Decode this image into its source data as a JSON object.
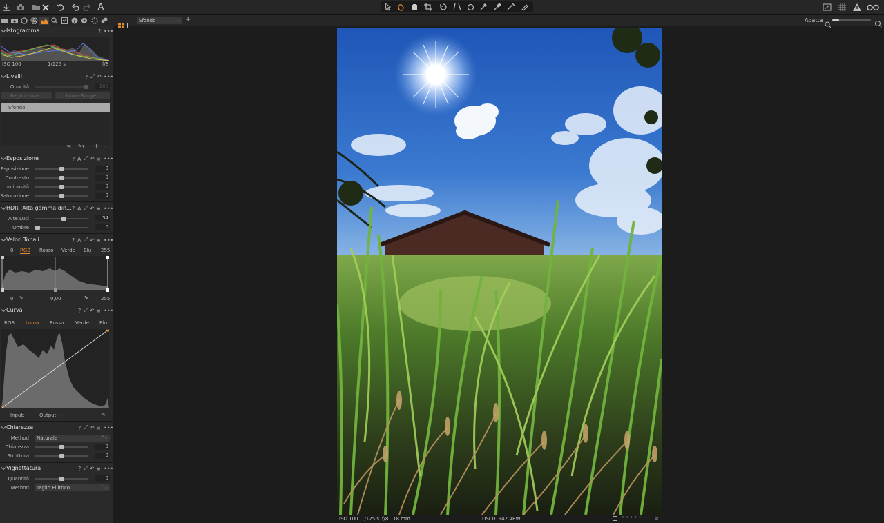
{
  "zoom": {
    "label": "Adatta"
  },
  "view": {
    "layer_select": "Sfondo"
  },
  "panels": {
    "istogramma": {
      "title": "Istogramma",
      "iso": "ISO 100",
      "shutter": "1/125 s",
      "aperture": "f/8"
    },
    "livelli": {
      "title": "Livelli",
      "opacita_label": "Opacità",
      "opacita_value": "100",
      "regolazione": "Regolazione",
      "luma_range": "Luma Range...",
      "layer_name": "Sfondo"
    },
    "esposizione": {
      "title": "Esposizione",
      "rows": [
        {
          "label": "Esposizione",
          "value": "0"
        },
        {
          "label": "Contrasto",
          "value": "0"
        },
        {
          "label": "Luminosità",
          "value": "0"
        },
        {
          "label": "Saturazione",
          "value": "0"
        }
      ]
    },
    "hdr": {
      "title": "HDR (Alta gamma din...",
      "rows": [
        {
          "label": "Alte Luci",
          "value": "54"
        },
        {
          "label": "Ombre",
          "value": "0"
        }
      ]
    },
    "valori_tonali": {
      "title": "Valori Tonali",
      "left": "0",
      "right": "255",
      "tabs": [
        "RGB",
        "Rosso",
        "Verde",
        "Blu"
      ],
      "active_tab": "RGB",
      "in_black": "0",
      "mid": "0,00",
      "in_white": "255"
    },
    "curva": {
      "title": "Curva",
      "tabs": [
        "RGB",
        "Luma",
        "Rosso",
        "Verde",
        "Blu"
      ],
      "active_tab": "Luma",
      "input_label": "Input:",
      "input_value": "--",
      "output_label": "Output:",
      "output_value": "--"
    },
    "chiarezza": {
      "title": "Chiarezza",
      "method_label": "Method",
      "method_value": "Naturale",
      "rows": [
        {
          "label": "Chiarezza",
          "value": "0"
        },
        {
          "label": "Struttura",
          "value": "0"
        }
      ]
    },
    "vignettatura": {
      "title": "Vignettatura",
      "quantita_label": "Quantità",
      "quantita_value": "0",
      "method_label": "Method",
      "method_value": "Taglio Ellittico"
    }
  },
  "status": {
    "iso": "ISO 100",
    "shutter": "1/125 s",
    "aperture": "f/8",
    "focal": "18 mm",
    "filename": "DSC01942.ARW"
  },
  "colors": {
    "accent": "#e8892b",
    "panel": "#2a2a2a",
    "background": "#1c1c1c"
  }
}
